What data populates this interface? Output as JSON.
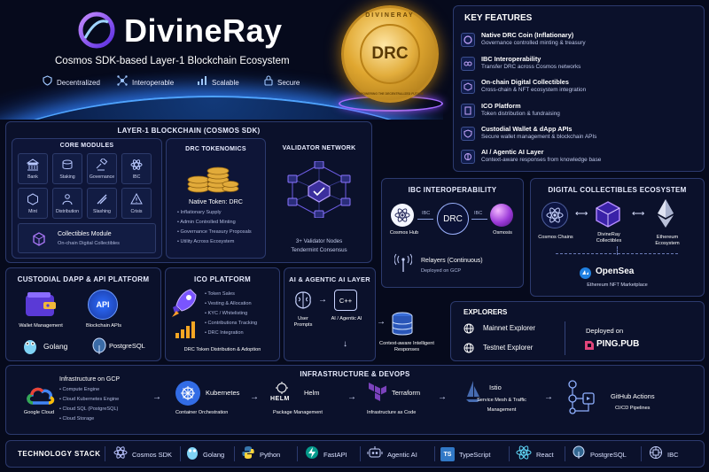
{
  "header": {
    "brand": "DivineRay",
    "subtitle": "Cosmos SDK-based Layer-1 Blockchain Ecosystem",
    "badges": [
      "Decentralized",
      "Interoperable",
      "Scalable",
      "Secure"
    ]
  },
  "coin": {
    "symbol": "DRC",
    "rim_text": "DIVINERAY",
    "rim_text_bottom": "EMPOWERING THE DECENTRALIZED FUTURE",
    "color": "#e0a730"
  },
  "key_features": {
    "title": "KEY FEATURES",
    "items": [
      {
        "title": "Native DRC Coin (Inflationary)",
        "sub": "Governance controlled minting & treasury"
      },
      {
        "title": "IBC Interoperability",
        "sub": "Transfer DRC across Cosmos networks"
      },
      {
        "title": "On-chain Digital Collectibles",
        "sub": "Cross-chain & NFT ecosystem integration"
      },
      {
        "title": "ICO Platform",
        "sub": "Token distribution & fundraising"
      },
      {
        "title": "Custodial Wallet & dApp APIs",
        "sub": "Secure wallet management & blockchain APIs"
      },
      {
        "title": "AI / Agentic AI Layer",
        "sub": "Context-aware responses from knowledge base"
      }
    ]
  },
  "layer1": {
    "title": "LAYER-1 BLOCKCHAIN (COSMOS SDK)",
    "core_modules": {
      "title": "CORE MODULES",
      "items": [
        "Bank",
        "Staking",
        "Governance",
        "IBC",
        "Mint",
        "Distribution",
        "Slashing",
        "Crisis"
      ],
      "collectibles_title": "Collectibles Module",
      "collectibles_sub": "On-chain Digital Collectibles"
    },
    "tokenomics": {
      "title": "DRC TOKENOMICS",
      "native": "Native Token: DRC",
      "bullets": [
        "Inflationary Supply",
        "Admin Controlled Minting",
        "Governance Treasury Proposals",
        "Utility Across Ecosystem"
      ]
    },
    "validator": {
      "title": "VALIDATOR NETWORK",
      "line1": "3+ Validator Nodes",
      "line2": "Tendermint Consensus"
    }
  },
  "ibc": {
    "title": "IBC INTEROPERABILITY",
    "left": "Cosmos Hub",
    "center": "DRC",
    "right": "Osmosis",
    "link_label": "IBC",
    "relayers": "Relayers (Continuous)",
    "deployed": "Deployed on GCP"
  },
  "collectibles": {
    "title": "DIGITAL COLLECTIBLES ECOSYSTEM",
    "left": "Cosmos Chains",
    "center": "DivineRay Collectibles",
    "right": "Ethereum Ecosystem",
    "market_name": "OpenSea",
    "market_sub": "Ethereum NFT Marketplace"
  },
  "custodial": {
    "title": "CUSTODIAL DAPP & API PLATFORM",
    "wallet": "Wallet Management",
    "api": "Blockchain APIs",
    "api_icon_text": "API",
    "lang1": "Golang",
    "lang2": "PostgreSQL"
  },
  "ico": {
    "title": "ICO PLATFORM",
    "bullets": [
      "Token Sales",
      "Vesting & Allocation",
      "KYC / Whitelisting",
      "Contributions Tracking",
      "DRC Integration"
    ],
    "footer": "DRC Token Distribution & Adoption"
  },
  "ai": {
    "title": "AI & AGENTIC AI LAYER",
    "user": "User Prompts",
    "agent": "AI / Agentic AI",
    "agent_icon_text": "C++",
    "kb": "Context-aware Intelligent Responses"
  },
  "explorers": {
    "title": "EXPLORERS",
    "items": [
      "Mainnet Explorer",
      "Testnet Explorer"
    ],
    "deployed_on": "Deployed on",
    "provider": "PING.PUB"
  },
  "infra": {
    "title": "INFRASTRUCTURE & DEVOPS",
    "gcp_label": "Google Cloud",
    "gcp_title": "Infrastructure on GCP",
    "gcp_items": [
      "Compute Engine",
      "Cloud Kubernetes Engine",
      "Cloud SQL (PostgreSQL)",
      "Cloud Storage"
    ],
    "steps": [
      {
        "name": "Kubernetes",
        "sub": "Container Orchestration"
      },
      {
        "name": "Helm",
        "sub": "Package Management",
        "icon_text": "HELM"
      },
      {
        "name": "Terraform",
        "sub": "Infrastructure as Code"
      },
      {
        "name": "Istio",
        "sub": "Service Mesh & Traffic Management"
      },
      {
        "name": "GitHub Actions",
        "sub": "CI/CD Pipelines"
      }
    ]
  },
  "tech_stack": {
    "title": "TECHNOLOGY STACK",
    "items": [
      "Cosmos SDK",
      "Golang",
      "Python",
      "FastAPI",
      "Agentic AI",
      "TypeScript",
      "React",
      "PostgreSQL",
      "IBC"
    ],
    "ts_icon_text": "TS"
  },
  "colors": {
    "background": "#060a1c",
    "panel_border": "#2c3a6e",
    "accent_purple": "#8a5cff",
    "accent_gold": "#e0a730",
    "accent_blue": "#3b8bff"
  }
}
